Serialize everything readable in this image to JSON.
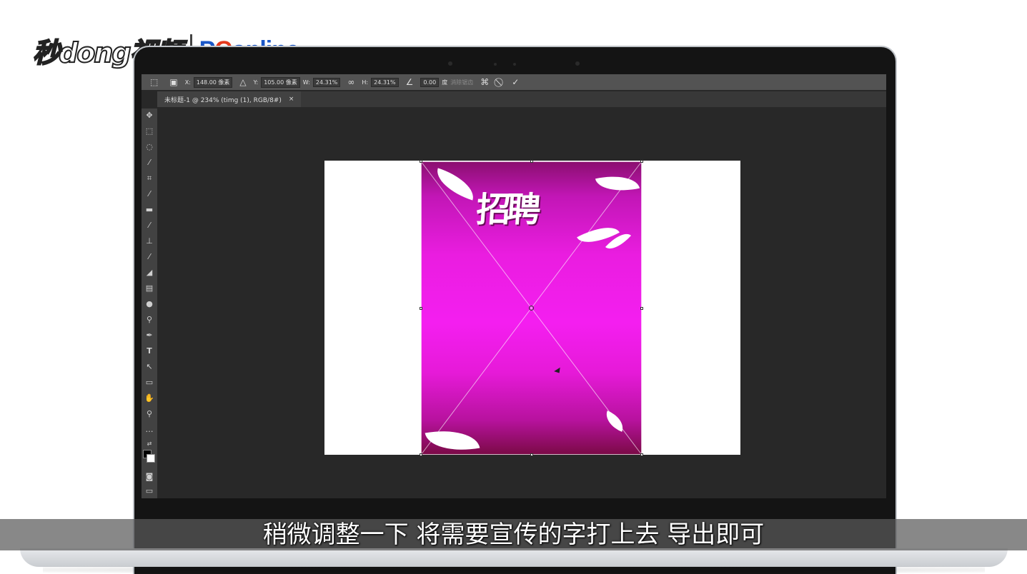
{
  "watermark": {
    "brand_cn": "秒dong视频",
    "brand_en_p": "P",
    "brand_en_c": "C",
    "brand_en_rest": "online"
  },
  "options_bar": {
    "x_label": "X:",
    "x_value": "148.00 像素",
    "y_label": "Y:",
    "y_value": "105.00 像素",
    "w_label": "W:",
    "w_value": "24.31%",
    "h_label": "H:",
    "h_value": "24.31%",
    "angle_value": "0.00",
    "angle_unit": "度",
    "interp_label": "消除锯齿",
    "cancel_symbol": "⃠",
    "commit_symbol": "✓"
  },
  "document_tab": {
    "title": "未标题-1 @ 234% (timg (1), RGB/8#)",
    "close": "×"
  },
  "poster": {
    "title": "招聘"
  },
  "subtitle": "稍微调整一下 将需要宣传的字打上去 导出即可",
  "colors": {
    "accent_magenta": "#f41ef0",
    "ps_panel": "#535353",
    "ps_workspace": "#282828"
  }
}
